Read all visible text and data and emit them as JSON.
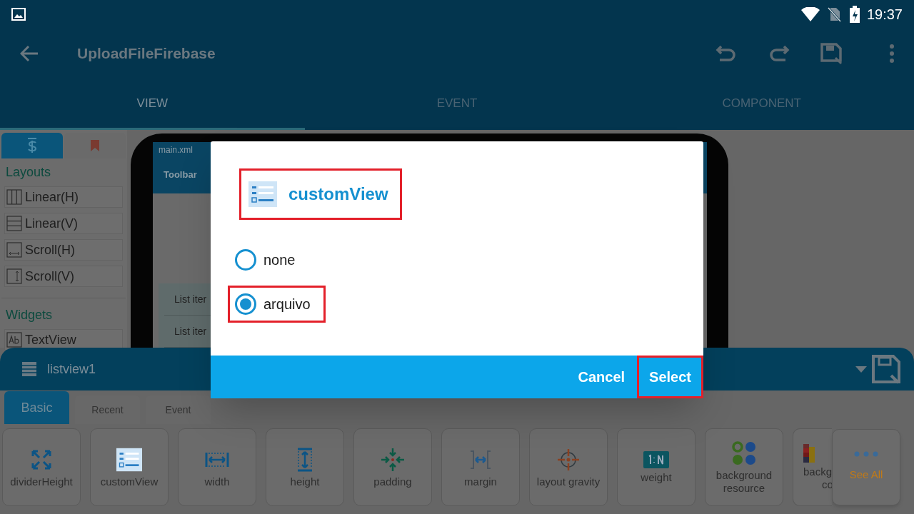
{
  "status_bar": {
    "time": "19:37"
  },
  "app_bar": {
    "title": "UploadFileFirebase"
  },
  "tabs": [
    {
      "label": "VIEW",
      "selected": true
    },
    {
      "label": "EVENT",
      "selected": false
    },
    {
      "label": "COMPONENT",
      "selected": false
    }
  ],
  "palette": {
    "tabs": [
      {
        "kind": "widgets",
        "selected": true
      },
      {
        "kind": "bookmark",
        "selected": false
      }
    ],
    "sections": [
      {
        "title": "Layouts",
        "items": [
          {
            "label": "Linear(H)",
            "kind": "linear_h"
          },
          {
            "label": "Linear(V)",
            "kind": "linear_v"
          },
          {
            "label": "Scroll(H)",
            "kind": "scroll_h"
          },
          {
            "label": "Scroll(V)",
            "kind": "scroll_v"
          }
        ]
      },
      {
        "title": "Widgets",
        "items": [
          {
            "label": "TextView",
            "kind": "textview"
          }
        ]
      }
    ]
  },
  "preview": {
    "file": "main.xml",
    "toolbar": "Toolbar",
    "list_items": [
      "List iter",
      "List iter"
    ]
  },
  "properties": {
    "widget": "listview1",
    "tabs": [
      {
        "label": "Basic",
        "selected": true
      },
      {
        "label": "Recent",
        "selected": false
      },
      {
        "label": "Event",
        "selected": false
      }
    ],
    "cards": [
      {
        "kind": "divider_height",
        "lines": [
          "dividerHeight"
        ]
      },
      {
        "kind": "custom_view",
        "lines": [
          "customView"
        ]
      },
      {
        "kind": "width",
        "lines": [
          "width"
        ]
      },
      {
        "kind": "height",
        "lines": [
          "height"
        ]
      },
      {
        "kind": "padding",
        "lines": [
          "padding"
        ]
      },
      {
        "kind": "margin",
        "lines": [
          "margin"
        ]
      },
      {
        "kind": "gravity",
        "lines": [
          "layout gravity"
        ]
      },
      {
        "kind": "weight",
        "lines": [
          "weight"
        ]
      },
      {
        "kind": "background_resource",
        "lines": [
          "background",
          "resource"
        ]
      },
      {
        "kind": "background_color",
        "lines": [
          "backg",
          "co"
        ]
      }
    ],
    "see_all": "See All"
  },
  "dialog": {
    "title": "customView",
    "highlighted": true,
    "options": [
      {
        "label": "none",
        "selected": false,
        "highlighted": false
      },
      {
        "label": "arquivo",
        "selected": true,
        "highlighted": true
      }
    ],
    "buttons": [
      {
        "label": "Cancel",
        "highlighted": false
      },
      {
        "label": "Select",
        "highlighted": true
      }
    ]
  }
}
